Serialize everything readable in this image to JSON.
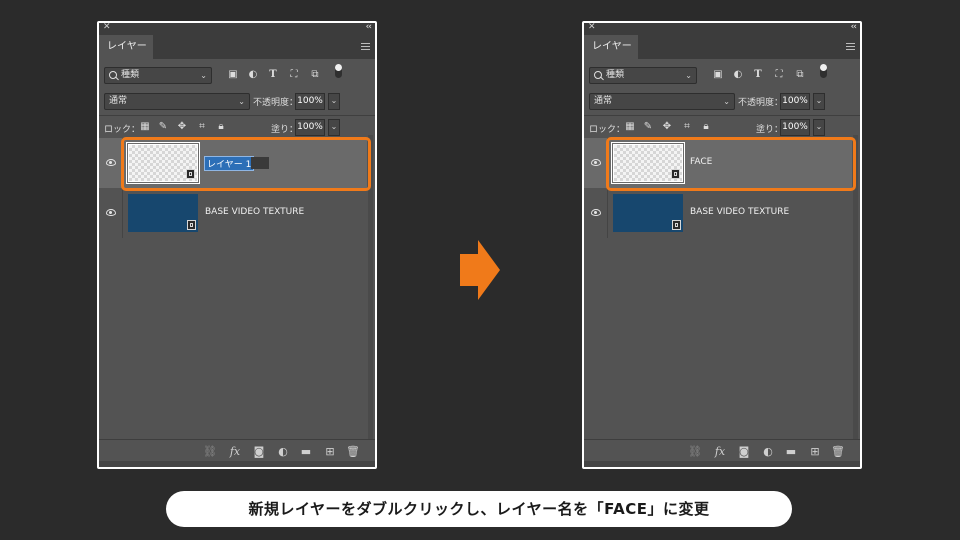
{
  "panel_tab": "レイヤー",
  "filter_select": "種類",
  "blend_mode": "通常",
  "opacity_label": "不透明度：",
  "opacity_value": "100%",
  "lock_label": "ロック：",
  "fill_label": "塗り：",
  "fill_value": "100%",
  "before": {
    "layers": [
      {
        "name": "レイヤー 1",
        "editing": true,
        "selected": true
      },
      {
        "name": "BASE VIDEO TEXTURE",
        "selected": false
      }
    ]
  },
  "after": {
    "layers": [
      {
        "name": "FACE",
        "editing": false,
        "selected": true
      },
      {
        "name": "BASE VIDEO TEXTURE",
        "selected": false
      }
    ]
  },
  "caption": "新規レイヤーをダブルクリックし、レイヤー名を「FACE」に変更",
  "colors": {
    "highlight": "#f07a1a",
    "arrow": "#f07a1a",
    "selection": "#2d6fb7"
  },
  "icons": {
    "filter": [
      "image-filter-icon",
      "adjustment-filter-icon",
      "type-filter-icon",
      "shape-filter-icon",
      "smart-object-filter-icon"
    ],
    "lock": [
      "lock-transparent-icon",
      "lock-image-icon",
      "lock-position-icon",
      "lock-artboard-icon",
      "lock-all-icon"
    ],
    "footer": [
      "link-icon",
      "fx-icon",
      "mask-icon",
      "adjustment-icon",
      "group-folder-icon",
      "new-layer-icon",
      "trash-icon"
    ]
  }
}
